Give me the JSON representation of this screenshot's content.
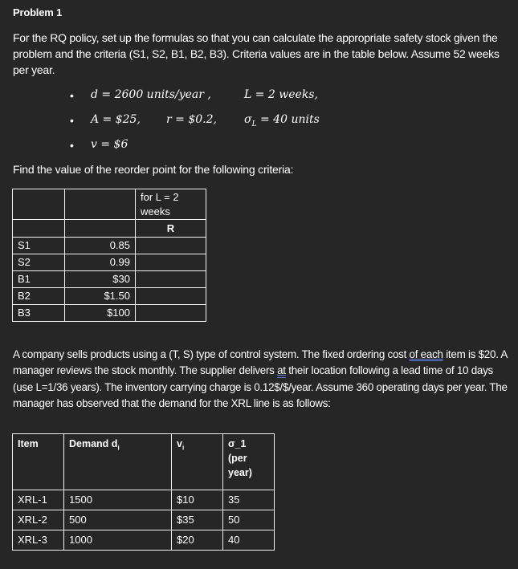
{
  "problem": {
    "title": "Problem 1",
    "intro": "For the RQ policy, set up the formulas so that you can calculate the appropriate safety stock given the problem and the criteria (S1, S2, B1, B2, B3).  Criteria values are in the table below. Assume 52 weeks per year.",
    "bullets": [
      {
        "items": [
          "d = 2600 units/year ,",
          "L = 2 weeks,"
        ]
      },
      {
        "items": [
          "A = $25,",
          "r = $0.2,",
          "σ_L = 40 units"
        ]
      },
      {
        "items": [
          "v = $6"
        ]
      }
    ],
    "bullet_symbol": "•",
    "find_text": "Find the value of the reorder point for the following criteria:",
    "criteria_table": {
      "header_col3_line1": "for L = 2",
      "header_col3_line2": "weeks",
      "subheader_col3": "R",
      "rows": [
        {
          "label": "S1",
          "value": "0.85",
          "r": ""
        },
        {
          "label": "S2",
          "value": "0.99",
          "r": ""
        },
        {
          "label": "B1",
          "value": "$30",
          "r": ""
        },
        {
          "label": "B2",
          "value": "$1.50",
          "r": ""
        },
        {
          "label": "B3",
          "value": "$100",
          "r": ""
        }
      ]
    }
  },
  "problem2": {
    "text_parts": [
      "A company sells products using a (T, S) type of control system.  The fixed ordering cost ",
      "of  each",
      " item is $20. A manager reviews the stock monthly.  The supplier delivers ",
      "at",
      " their location following a lead time of 10 days (use L=1/36 years).  The inventory carrying charge is 0.12$/$/year.  Assume 360 operating days per year.  The manager has observed that the demand for the XRL line is as follows:"
    ],
    "table": {
      "headers": [
        "Item",
        "Demand d",
        "v",
        "σ_1 (per year)"
      ],
      "header_subscripts": [
        "",
        "i",
        "i",
        ""
      ],
      "rows": [
        {
          "item": "XRL-1",
          "demand": "1500",
          "v": "$10",
          "sigma": "35"
        },
        {
          "item": "XRL-2",
          "demand": "500",
          "v": "$35",
          "sigma": "50"
        },
        {
          "item": "XRL-3",
          "demand": "1000",
          "v": "$20",
          "sigma": "40"
        }
      ]
    }
  },
  "colors": {
    "background": "#262626",
    "text": "#ffffff",
    "grammar_underline": "#5b7fdb"
  }
}
